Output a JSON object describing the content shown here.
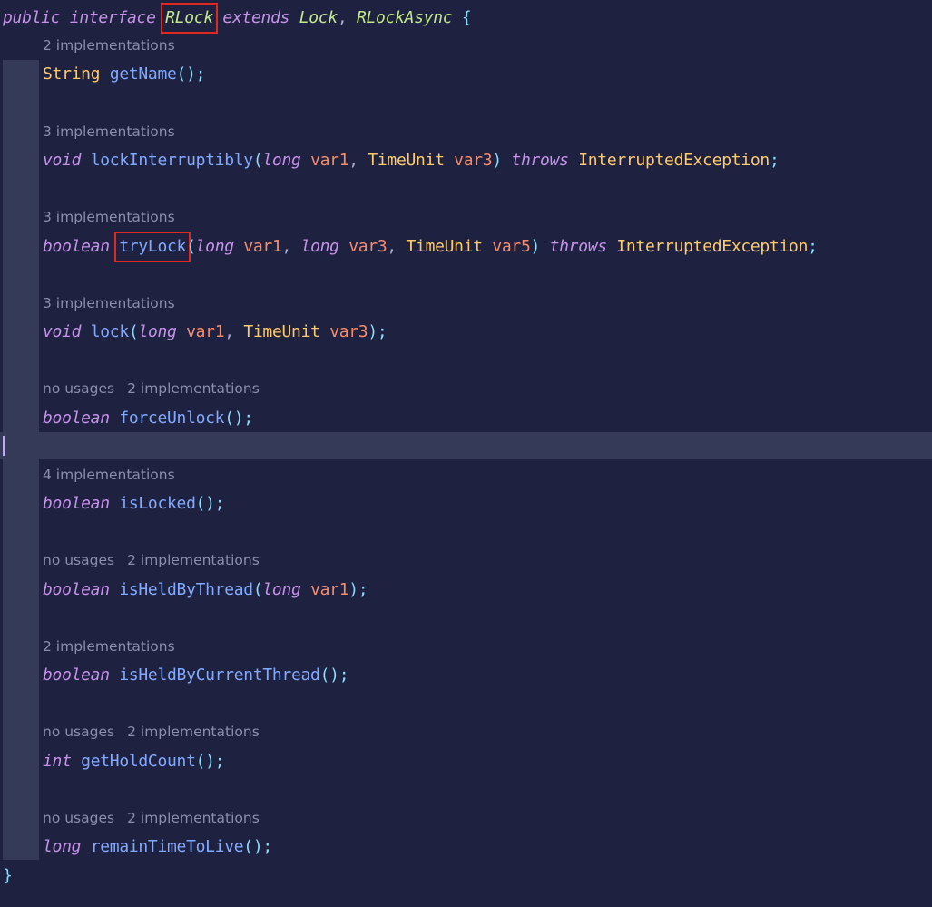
{
  "code": {
    "header": {
      "kw_public": "public",
      "kw_interface": "interface",
      "name": "RLock",
      "kw_extends": "extends",
      "super1": "Lock",
      "comma": ",",
      "super2": "RLockAsync",
      "brace_open": "{"
    },
    "closing_brace": "}"
  },
  "methods": [
    {
      "hint": [
        "2 implementations"
      ],
      "return_type": "String",
      "name": "getName",
      "params": [],
      "throws": "",
      "tail": "();"
    },
    {
      "hint": [
        "3 implementations"
      ],
      "return_type": "void",
      "name": "lockInterruptibly",
      "params": [
        {
          "type": "long",
          "name": "var1"
        },
        {
          "type": "TimeUnit",
          "name": "var3"
        }
      ],
      "throws": "InterruptedException"
    },
    {
      "hint": [
        "3 implementations"
      ],
      "return_type": "boolean",
      "name": "tryLock",
      "params": [
        {
          "type": "long",
          "name": "var1"
        },
        {
          "type": "long",
          "name": "var3"
        },
        {
          "type": "TimeUnit",
          "name": "var5"
        }
      ],
      "throws": "InterruptedException"
    },
    {
      "hint": [
        "3 implementations"
      ],
      "return_type": "void",
      "name": "lock",
      "params": [
        {
          "type": "long",
          "name": "var1"
        },
        {
          "type": "TimeUnit",
          "name": "var3"
        }
      ],
      "throws": ""
    },
    {
      "hint": [
        "no usages",
        "2 implementations"
      ],
      "return_type": "boolean",
      "name": "forceUnlock",
      "params": [],
      "throws": ""
    },
    {
      "hint": [
        "4 implementations"
      ],
      "return_type": "boolean",
      "name": "isLocked",
      "params": [],
      "throws": ""
    },
    {
      "hint": [
        "no usages",
        "2 implementations"
      ],
      "return_type": "boolean",
      "name": "isHeldByThread",
      "params": [
        {
          "type": "long",
          "name": "var1"
        }
      ],
      "throws": ""
    },
    {
      "hint": [
        "2 implementations"
      ],
      "return_type": "boolean",
      "name": "isHeldByCurrentThread",
      "params": [],
      "throws": ""
    },
    {
      "hint": [
        "no usages",
        "2 implementations"
      ],
      "return_type": "int",
      "name": "getHoldCount",
      "params": [],
      "throws": ""
    },
    {
      "hint": [
        "no usages",
        "2 implementations"
      ],
      "return_type": "long",
      "name": "remainTimeToLive",
      "params": [],
      "throws": ""
    }
  ],
  "highlighted": [
    "RLock",
    "tryLock"
  ],
  "colors": {
    "background": "#1e2140",
    "keyword": "#c792ea",
    "type": "#ffcb6b",
    "function": "#82aaff",
    "parameter": "#f78c6c",
    "punctuation": "#89ddff",
    "hint": "#8a8fab",
    "highlight_box": "#e0281e"
  }
}
